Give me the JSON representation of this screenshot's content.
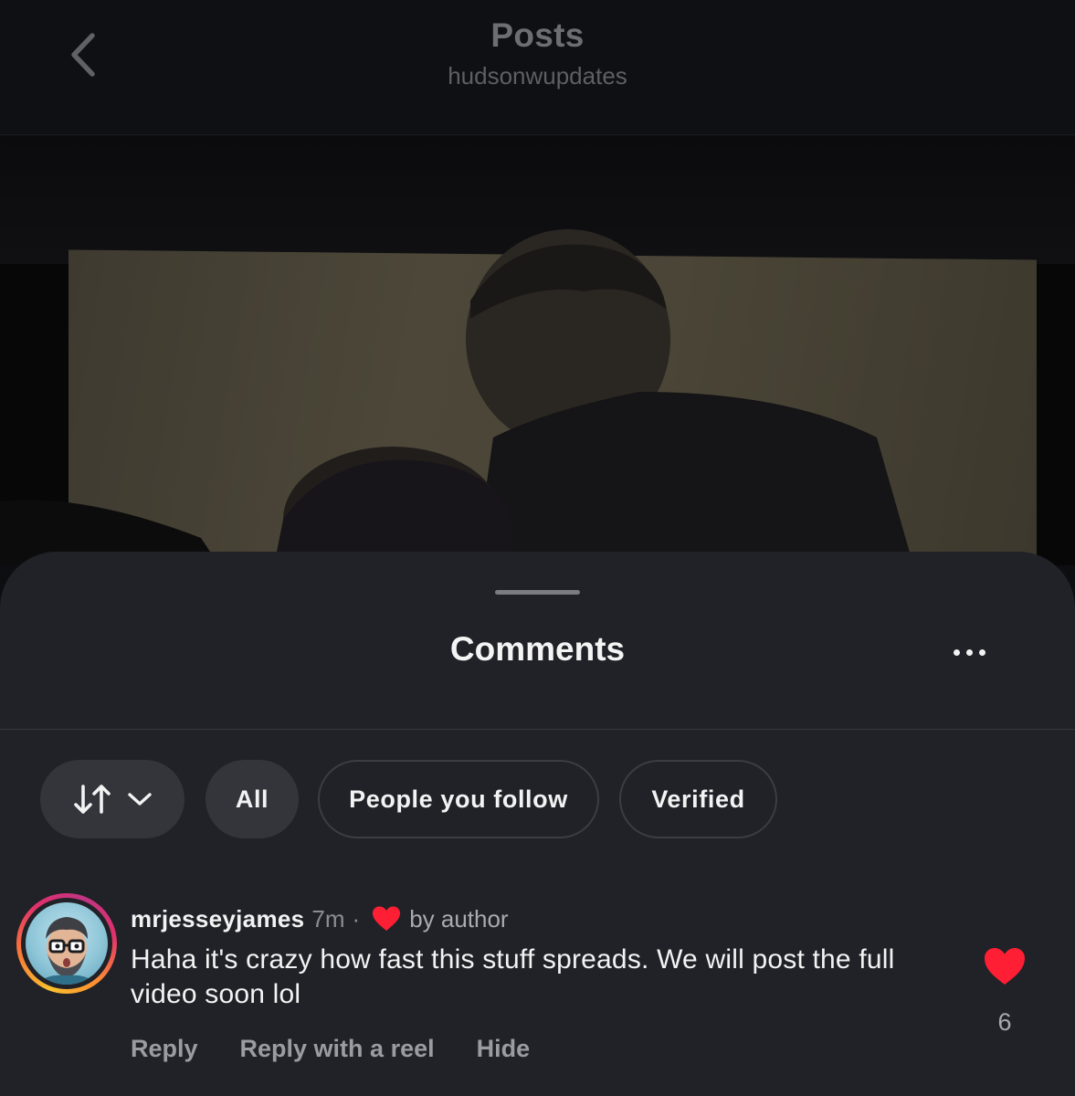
{
  "header": {
    "title": "Posts",
    "subtitle": "hudsonwupdates"
  },
  "sheet": {
    "title": "Comments"
  },
  "filters": {
    "all": "All",
    "people_you_follow": "People you follow",
    "verified": "Verified"
  },
  "comment": {
    "username": "mrjesseyjames",
    "time": "7m",
    "separator": "·",
    "liked_by": "by author",
    "text": "Haha it's crazy how fast this stuff spreads. We will post the full video soon lol",
    "likes": "6",
    "actions": {
      "reply": "Reply",
      "reply_reel": "Reply with a reel",
      "hide": "Hide"
    }
  },
  "colors": {
    "sheet_bg": "#212227",
    "heart": "#ff1f35",
    "chip_fill": "#33353b"
  }
}
